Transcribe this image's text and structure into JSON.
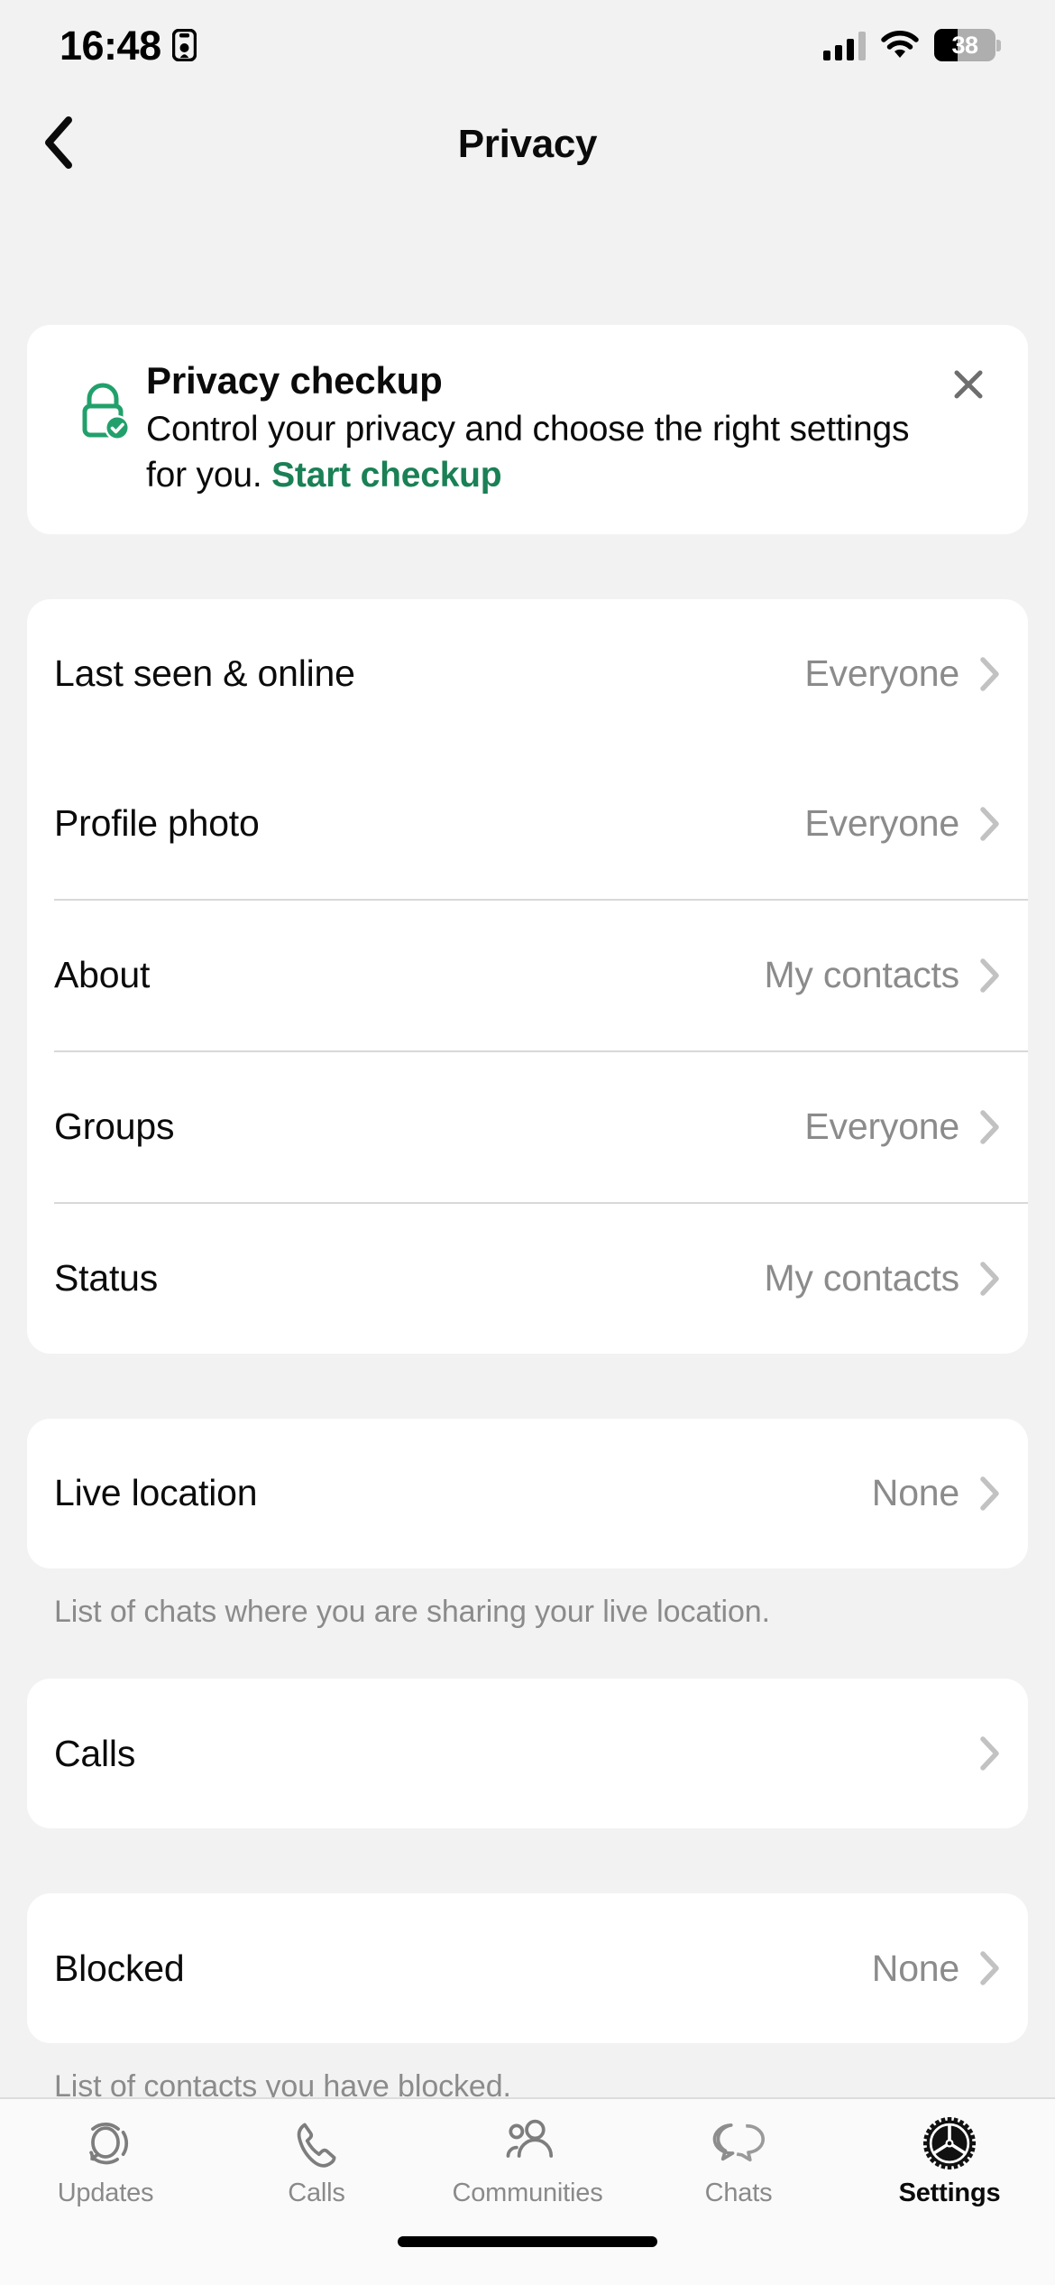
{
  "status_bar": {
    "time": "16:48",
    "lock_icon": "lock-portrait-icon",
    "signal_icon": "cellular-signal-icon",
    "wifi_icon": "wifi-icon",
    "battery_level": "38",
    "battery_percent": 38
  },
  "nav": {
    "back_icon": "chevron-left-icon",
    "title": "Privacy"
  },
  "checkup": {
    "icon": "lock-check-icon",
    "title": "Privacy checkup",
    "body": "Control your privacy and choose the right settings for you. ",
    "link_label": "Start checkup",
    "close_icon": "close-icon",
    "accent_color": "#1a8055"
  },
  "groups": [
    {
      "rows": [
        {
          "label": "Last seen & online",
          "value": "Everyone",
          "chevron": "chevron-right-icon",
          "separator_after": false
        },
        {
          "label": "Profile photo",
          "value": "Everyone",
          "chevron": "chevron-right-icon",
          "separator_after": true
        },
        {
          "label": "About",
          "value": "My contacts",
          "chevron": "chevron-right-icon",
          "separator_after": true
        },
        {
          "label": "Groups",
          "value": "Everyone",
          "chevron": "chevron-right-icon",
          "separator_after": true
        },
        {
          "label": "Status",
          "value": "My contacts",
          "chevron": "chevron-right-icon",
          "separator_after": false
        }
      ],
      "caption": ""
    },
    {
      "rows": [
        {
          "label": "Live location",
          "value": "None",
          "chevron": "chevron-right-icon",
          "separator_after": false
        }
      ],
      "caption": "List of chats where you are sharing your live location."
    },
    {
      "rows": [
        {
          "label": "Calls",
          "value": "",
          "chevron": "chevron-right-icon",
          "separator_after": false
        }
      ],
      "caption": ""
    },
    {
      "rows": [
        {
          "label": "Blocked",
          "value": "None",
          "chevron": "chevron-right-icon",
          "separator_after": false
        }
      ],
      "caption": "List of contacts you have blocked."
    }
  ],
  "tabbar": {
    "items": [
      {
        "label": "Updates",
        "icon": "updates-icon",
        "active": false
      },
      {
        "label": "Calls",
        "icon": "phone-icon",
        "active": false
      },
      {
        "label": "Communities",
        "icon": "communities-icon",
        "active": false
      },
      {
        "label": "Chats",
        "icon": "chats-icon",
        "active": false
      },
      {
        "label": "Settings",
        "icon": "gear-icon",
        "active": true
      }
    ]
  },
  "colors": {
    "page_background": "#f2f2f2",
    "card_background": "#ffffff",
    "primary_text": "#0b0b0b",
    "secondary_text": "#8b8b8b",
    "accent_green": "#1a8055",
    "separator": "#d8d8d8"
  }
}
